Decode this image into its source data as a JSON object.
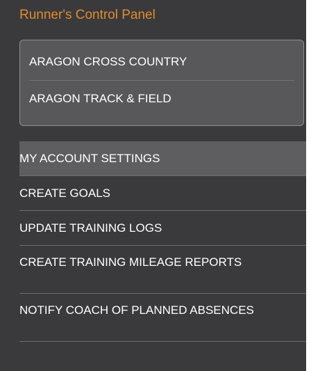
{
  "panel": {
    "title": "Runner's Control Panel",
    "teams": [
      {
        "label": "ARAGON CROSS COUNTRY"
      },
      {
        "label": "ARAGON TRACK & FIELD"
      }
    ],
    "menu": [
      {
        "label": "MY ACCOUNT SETTINGS",
        "active": true
      },
      {
        "label": "CREATE GOALS",
        "active": false
      },
      {
        "label": "UPDATE TRAINING LOGS",
        "active": false
      },
      {
        "label": "CREATE TRAINING MILEAGE REPORTS",
        "active": false
      },
      {
        "label": "NOTIFY COACH OF PLANNED ABSENCES",
        "active": false
      }
    ]
  },
  "colors": {
    "panel_bg": "#3a3a3c",
    "title_accent": "#e28a2e",
    "active_item_bg": "#5e5e60"
  }
}
